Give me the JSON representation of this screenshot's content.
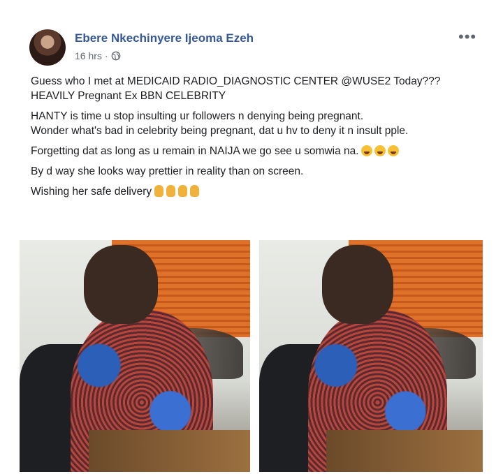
{
  "post": {
    "author": "Ebere Nkechinyere Ijeoma Ezeh",
    "time": "16 hrs",
    "separator": "·",
    "lines": [
      "Guess who I met at MEDICAID RADIO_DIAGNOSTIC CENTER @WUSE2 Today???",
      "HEAVILY Pregnant Ex BBN CELEBRITY",
      "HANTY is time u stop insulting ur followers n denying being pregnant.",
      "Wonder what's bad in celebrity being pregnant, dat u hv to deny it n insult pple.",
      "Forgetting dat as long as u remain in NAIJA we go see u somwia na.",
      "By d way she looks way prettier in reality than on screen.",
      "Wishing her safe delivery"
    ]
  },
  "icons": {
    "more": "more-options-icon",
    "privacy": "globe-icon"
  },
  "colors": {
    "author": "#365899",
    "text": "#1c1e21",
    "meta": "#606770"
  }
}
